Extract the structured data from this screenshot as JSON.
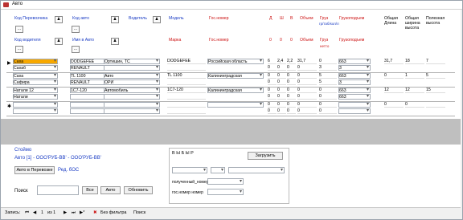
{
  "window": {
    "title": "Авто"
  },
  "filters": {
    "row1": [
      {
        "label": "Код Перевозчика",
        "color": "#1a3cc4"
      },
      {
        "label": "Код авто",
        "color": "#1a3cc4"
      },
      {
        "label": "Водитель",
        "color": "#1a3cc4"
      },
      {
        "label": "Модель",
        "color": "#1a3cc4"
      },
      {
        "label": "Гос.номер",
        "color": "#c11"
      }
    ],
    "row2": [
      {
        "label": "Код водителя",
        "color": "#1a3cc4"
      },
      {
        "label": "Имя в Авто",
        "color": "#1a3cc4"
      },
      {
        "label": "Марка",
        "color": "#c11"
      },
      {
        "label": "Гос.номер",
        "color": "#c11"
      }
    ],
    "sort_button": "..."
  },
  "columns": {
    "a": "Д",
    "b": "Ш",
    "c": "В",
    "obem": "Объем",
    "gruz": "Груз",
    "gruz_sub": "гр/таб/кол/л",
    "gruzpod": "Грузоподъем",
    "obsh": "Общая Длина",
    "obsh2": "Общая ширина высота",
    "polez": "Полезная высота",
    "r2_a": "0",
    "r2_b": "0",
    "r2_c": "0",
    "r2_obem": "Объем",
    "r2_gruz": "Груз",
    "r2_gruzpod": "Грузоподъем",
    "r2_gruz_sub": "нетто"
  },
  "rows": [
    {
      "name1": "Саха",
      "name2": "Сахаб",
      "model1": "DODGEFEE",
      "model2": "RENAULT",
      "driver1": "Ортишин, ТС",
      "driver2": "",
      "tag1": "DODGEFEE",
      "tag2": "",
      "place": "Российская область",
      "d1": "6",
      "s1": "2,4",
      "v1": "2,2",
      "o1": "31,7",
      "g1": "0",
      "gp1": "663",
      "d2": "0",
      "s2": "0",
      "v2": "0",
      "o2": "0",
      "g2": "3",
      "gp2": "3",
      "t1": "31,7",
      "t2": "18",
      "t3": "7"
    },
    {
      "name1": "Саха",
      "name2": "Сафира",
      "model1": "TL 1100",
      "model2": "RENAULT",
      "driver1": "Авто",
      "driver2": "ОРИ",
      "tag1": "TL 1100",
      "tag2": "",
      "place": "Калининградская",
      "d1": "0",
      "s1": "0",
      "v1": "0",
      "o1": "0",
      "g1": "5",
      "gp1": "663",
      "d2": "0",
      "s2": "0",
      "v2": "0",
      "o2": "0",
      "g2": "5",
      "gp2": "3",
      "t1": "0",
      "t2": "1",
      "t3": "5"
    },
    {
      "name1": "Натали 12",
      "name2": "Натали",
      "model1": "1C7-120",
      "model2": "",
      "driver1": "Автомобиль",
      "driver2": "",
      "tag1": "1C7-120",
      "tag2": "",
      "place": "Калининградская",
      "d1": "0",
      "s1": "0",
      "v1": "0",
      "o1": "0",
      "g1": "0",
      "gp1": "663",
      "d2": "0",
      "s2": "0",
      "v2": "0",
      "o2": "0",
      "g2": "0",
      "gp2": "663",
      "t1": "12",
      "t2": "12",
      "t3": "15"
    },
    {
      "name1": "",
      "name2": "",
      "model1": "",
      "model2": "",
      "driver1": "",
      "driver2": "",
      "tag1": "",
      "tag2": "",
      "place": "",
      "d1": "0",
      "s1": "0",
      "v1": "0",
      "o1": "0",
      "g1": "0",
      "gp1": "",
      "d2": "0",
      "s2": "0",
      "v2": "0",
      "o2": "0",
      "g2": "0",
      "gp2": "",
      "t1": "0",
      "t2": "0",
      "t3": ""
    }
  ],
  "footer": {
    "line1": "Стоймо",
    "line2": "Авто [1] - ООО'РУБ-ВВ' - ООО'РУБ-ВВ'",
    "btn_add": "Авто в Перевозке",
    "badge": "Ред. бОС",
    "search_label": "Поиск",
    "search_value": "",
    "btn_find": "Все",
    "btn_all": "Авто",
    "btn_update": "Обновить",
    "right_title": "В Ы Б Ы Р",
    "right_btn": "Загрузить",
    "right_lbl1": "полученный_номер",
    "right_lbl2": "гос.номер номер"
  },
  "status": {
    "record_label": "Запись:",
    "record_num": "1",
    "of": "из 1",
    "filter": "Без фильтра",
    "search": "Поиск"
  }
}
